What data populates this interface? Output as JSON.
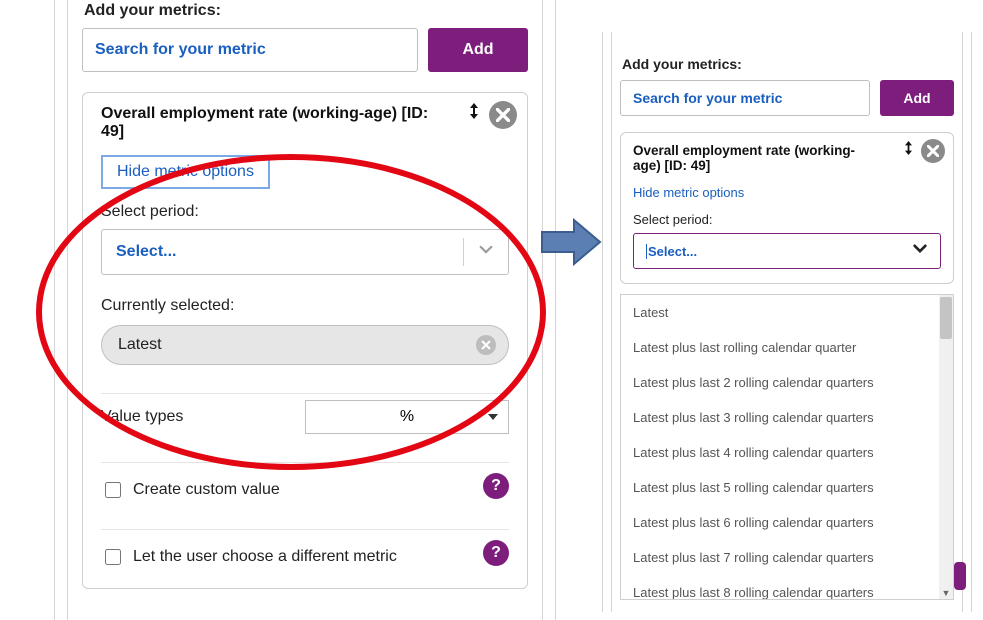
{
  "left": {
    "add_label": "Add your metrics:",
    "search_placeholder": "Search for your metric",
    "add_button": "Add",
    "metric": {
      "title": "Overall employment rate (working-age) [ID: 49]",
      "hide_options": "Hide metric options",
      "select_period_label": "Select period:",
      "select_placeholder": "Select...",
      "currently_selected_label": "Currently selected:",
      "selected_pill": "Latest",
      "value_types_label": "Value types",
      "value_types_value": "%",
      "create_custom_label": "Create custom value",
      "choose_metric_label": "Let the user choose a different metric"
    }
  },
  "right": {
    "add_label": "Add your metrics:",
    "search_placeholder": "Search for your metric",
    "add_button": "Add",
    "metric": {
      "title": "Overall employment rate (working-age) [ID: 49]",
      "hide_options": "Hide metric options",
      "select_period_label": "Select period:",
      "select_placeholder": "Select..."
    },
    "period_options": [
      "Latest",
      "Latest plus last rolling calendar quarter",
      "Latest plus last 2 rolling calendar quarters",
      "Latest plus last 3 rolling calendar quarters",
      "Latest plus last 4 rolling calendar quarters",
      "Latest plus last 5 rolling calendar quarters",
      "Latest plus last 6 rolling calendar quarters",
      "Latest plus last 7 rolling calendar quarters",
      "Latest plus last 8 rolling calendar quarters"
    ]
  },
  "colors": {
    "accent_purple": "#7d1e7d",
    "link_blue": "#1a5fbf",
    "highlight_red": "#e30613"
  }
}
